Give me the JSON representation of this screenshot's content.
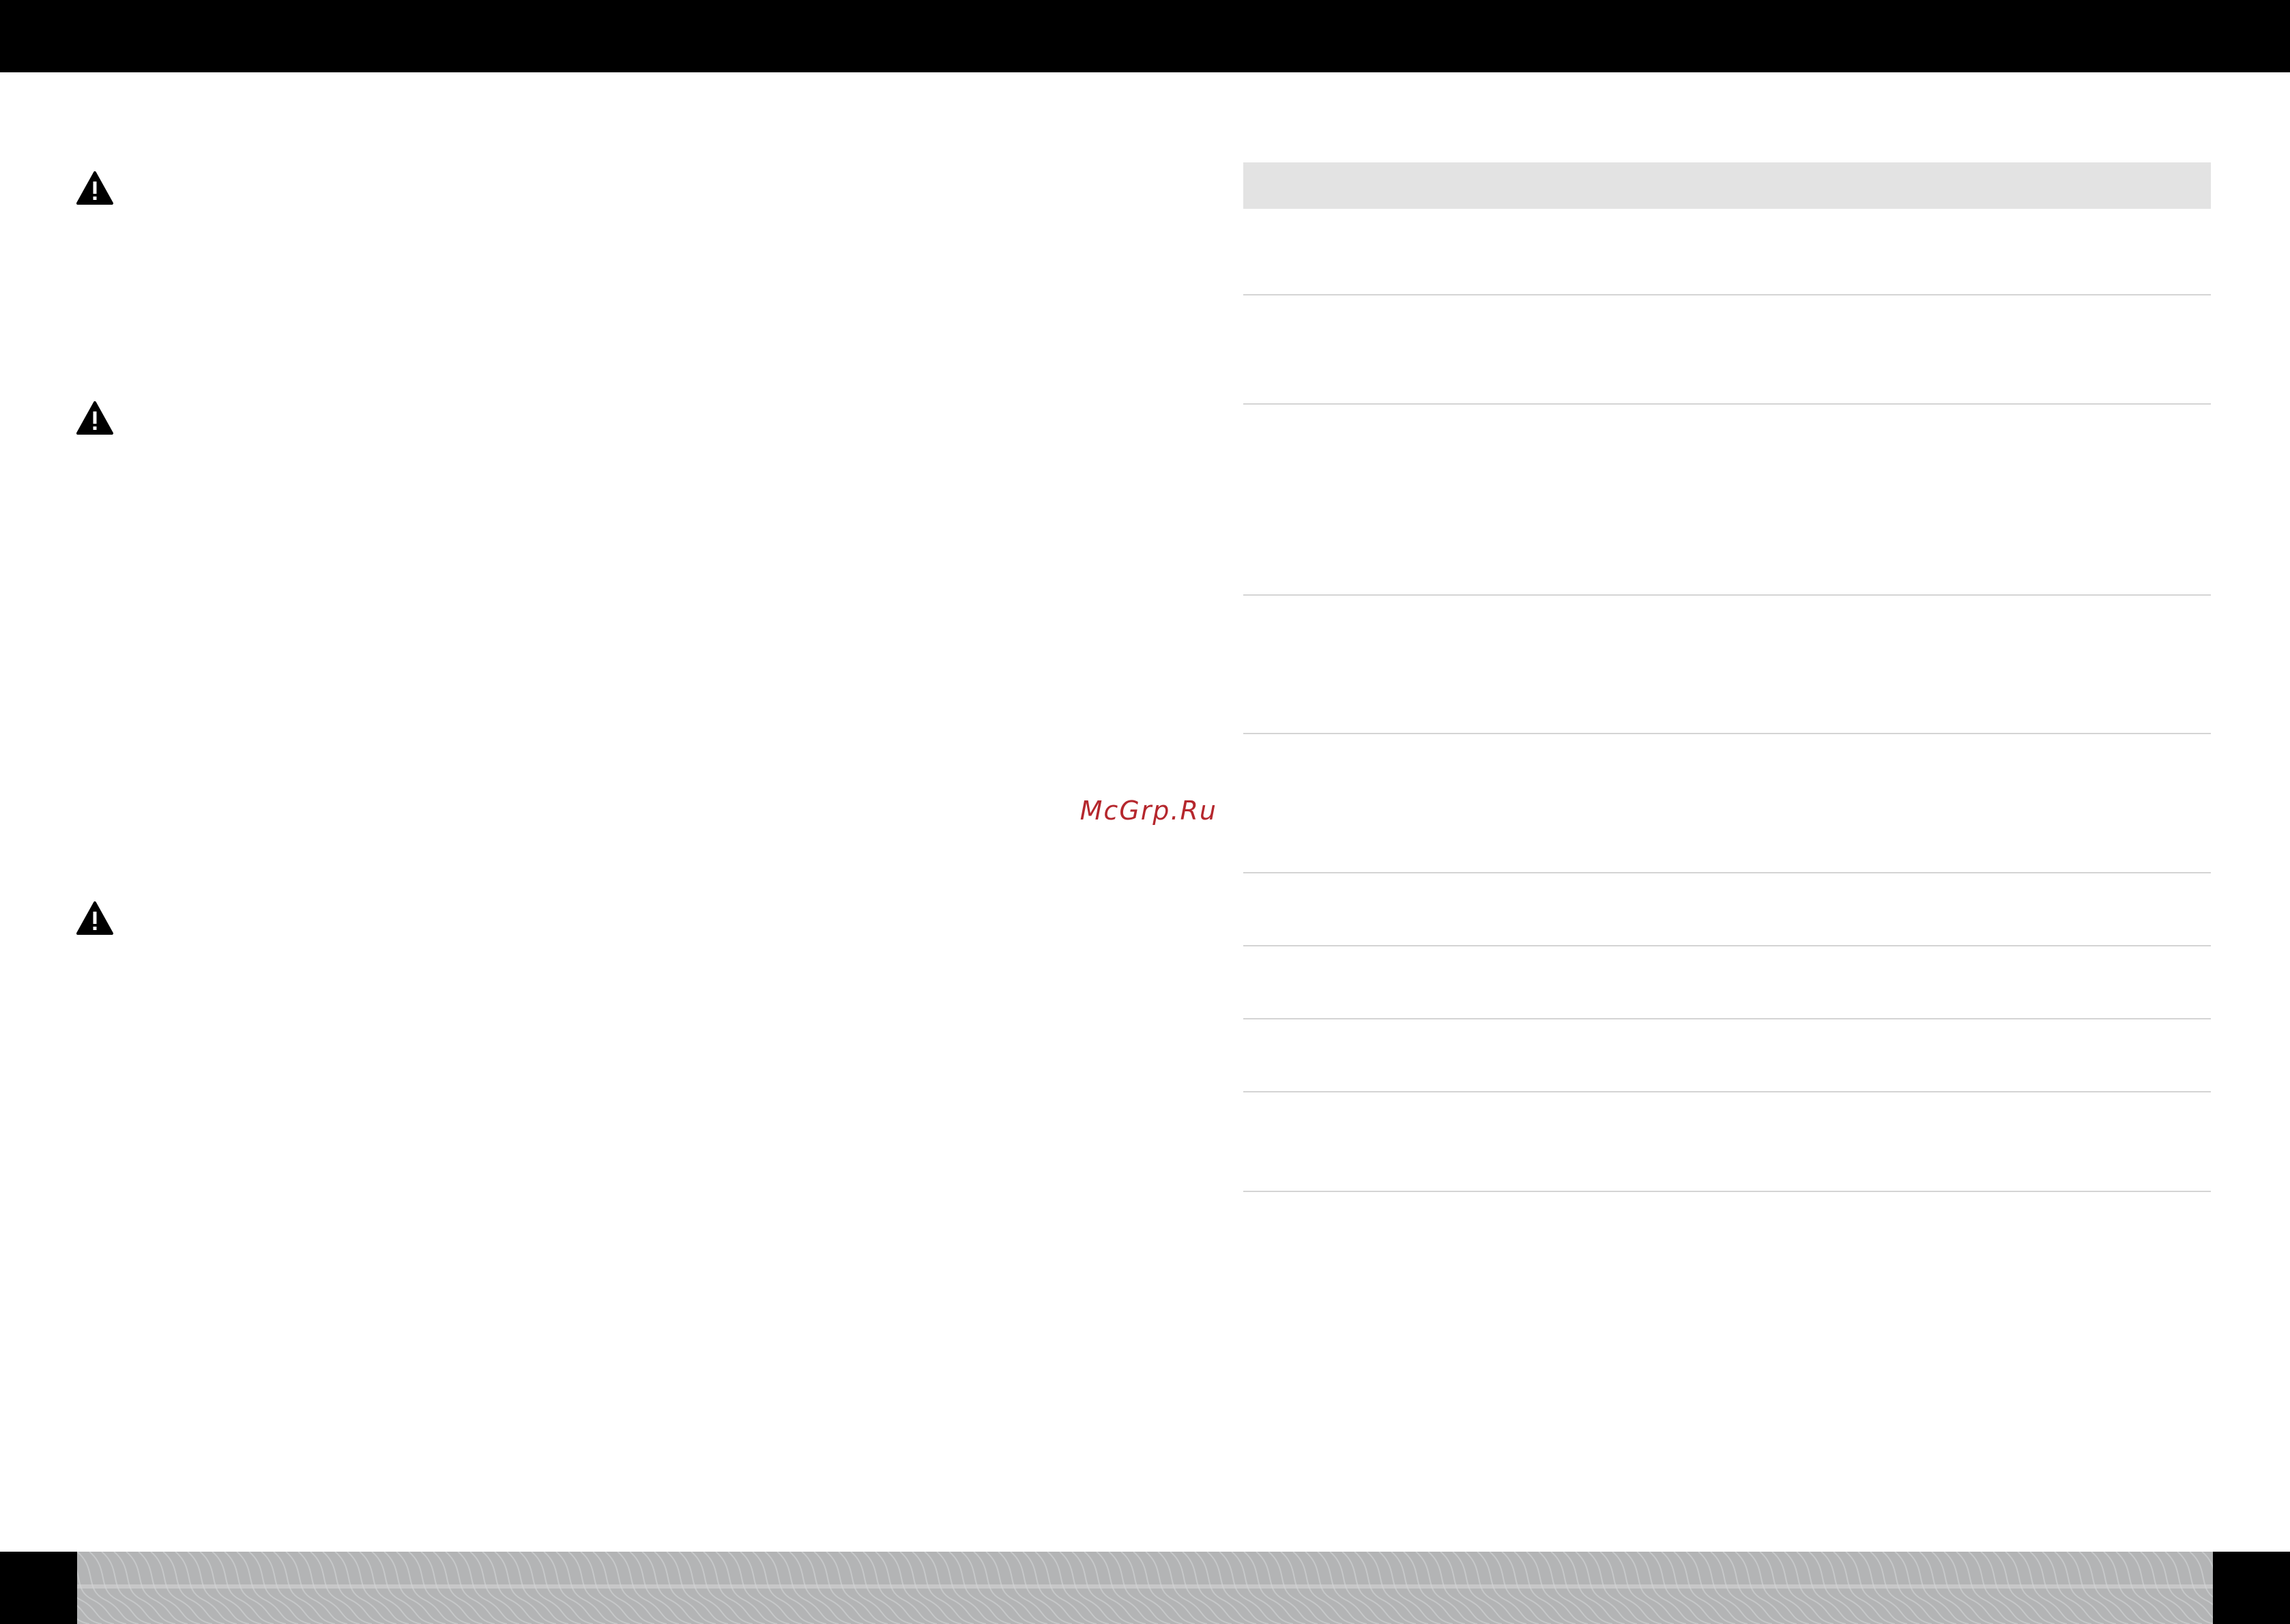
{
  "watermark": {
    "text": "McGrp.Ru",
    "color": "#b5272d"
  },
  "icons": [
    "warning-icon",
    "warning-icon",
    "warning-icon"
  ],
  "table": {
    "header_color": "#e3e3e3",
    "row_count": 9
  },
  "footer": {
    "band_color": "#b3b4b5"
  }
}
